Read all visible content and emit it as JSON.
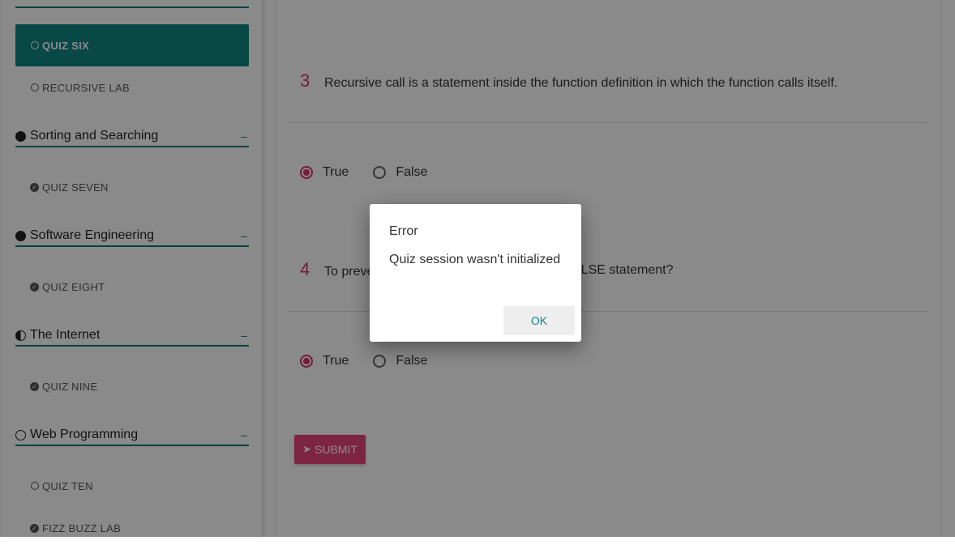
{
  "sidebar": {
    "items": [
      {
        "label": "QUIZ SIX",
        "icon": "circle-outline-icon",
        "active": true
      },
      {
        "label": "RECURSIVE LAB",
        "icon": "circle-outline-icon"
      },
      {
        "label": "QUIZ SEVEN",
        "icon": "check-circle-icon"
      },
      {
        "label": "QUIZ EIGHT",
        "icon": "check-circle-icon"
      },
      {
        "label": "QUIZ NINE",
        "icon": "check-circle-icon"
      },
      {
        "label": "QUIZ TEN",
        "icon": "circle-outline-icon"
      },
      {
        "label": "FIZZ BUZZ LAB",
        "icon": "check-circle-icon"
      }
    ],
    "sections": [
      {
        "label": "Sorting and Searching",
        "icon": "filled-circle-icon",
        "toggle": "–"
      },
      {
        "label": "Software Engineering",
        "icon": "filled-circle-icon",
        "toggle": "–"
      },
      {
        "label": "The Internet",
        "icon": "half-circle-icon",
        "toggle": "–"
      },
      {
        "label": "Web Programming",
        "icon": "empty-circle-icon",
        "toggle": "–"
      }
    ]
  },
  "questions": [
    {
      "number": "3",
      "text": "Recursive call is a statement inside the function definition in which the function calls itself.",
      "options": [
        "True",
        "False"
      ],
      "selected": "True"
    },
    {
      "number": "4",
      "text_left": "To preve",
      "text_right": "ELSE statement?",
      "options": [
        "True",
        "False"
      ],
      "selected": "True"
    }
  ],
  "submit_label": "SUBMIT",
  "dialog": {
    "title": "Error",
    "message": "Quiz session wasn't initialized",
    "ok_label": "OK"
  },
  "colors": {
    "teal": "#0f8584",
    "accent": "#e8437b"
  }
}
